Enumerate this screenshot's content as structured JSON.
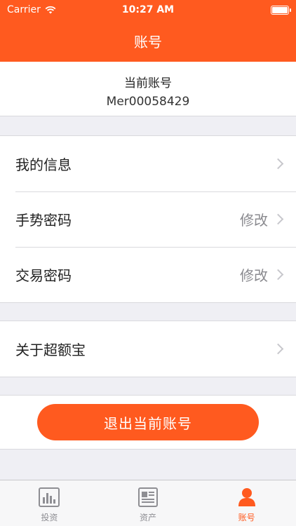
{
  "status_bar": {
    "carrier": "Carrier",
    "time": "10:27 AM"
  },
  "nav": {
    "title": "账号"
  },
  "account": {
    "label": "当前账号",
    "value": "Mer00058429"
  },
  "menu": {
    "my_info": "我的信息",
    "gesture_password": "手势密码",
    "gesture_action": "修改",
    "trade_password": "交易密码",
    "trade_action": "修改",
    "about": "关于超额宝"
  },
  "logout": {
    "label": "退出当前账号"
  },
  "tabbar": {
    "tabs": [
      {
        "label": "投资",
        "icon": "chart-icon"
      },
      {
        "label": "资产",
        "icon": "newspaper-icon"
      },
      {
        "label": "账号",
        "icon": "person-icon"
      }
    ]
  },
  "colors": {
    "accent": "#ff5a1f",
    "background": "#efeff4"
  }
}
